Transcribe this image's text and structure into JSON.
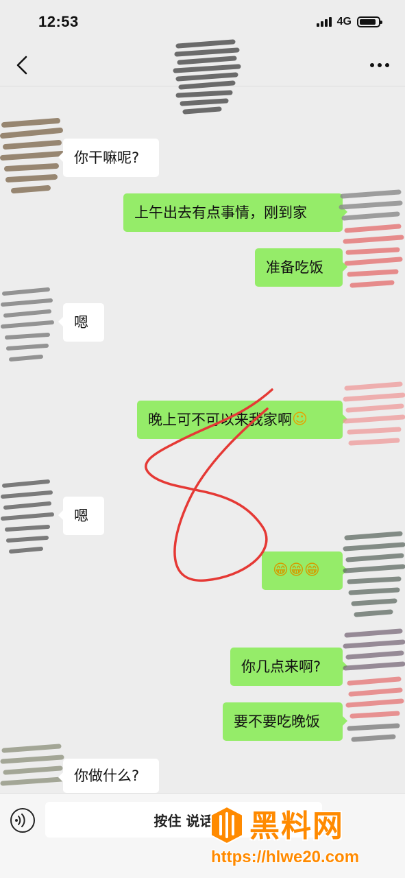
{
  "status_bar": {
    "time": "12:53",
    "network": "4G",
    "battery_level": 0.9
  },
  "nav": {
    "back_icon": "chevron-left-icon",
    "more_icon": "more-dots-icon"
  },
  "messages": [
    {
      "side": "in",
      "text": "你干嘛呢?"
    },
    {
      "side": "out",
      "text": "上午出去有点事情，刚到家"
    },
    {
      "side": "out",
      "text": "准备吃饭"
    },
    {
      "side": "in",
      "text": "嗯"
    },
    {
      "side": "out",
      "text": "晚上可不可以来我家啊",
      "emoji": "☺"
    },
    {
      "side": "in",
      "text": "嗯"
    },
    {
      "side": "out",
      "text": "",
      "emoji": "😁😁😁"
    },
    {
      "side": "out",
      "text": "你几点来啊?"
    },
    {
      "side": "out",
      "text": "要不要吃晚饭"
    },
    {
      "side": "in",
      "text": "你做什么?"
    }
  ],
  "input_bar": {
    "voice_icon": "voice-icon",
    "hold_to_talk": "按住 说话"
  },
  "watermark": {
    "title": "黑料网",
    "url": "https://hlwe20.com"
  },
  "colors": {
    "background": "#ededed",
    "outgoing_bubble": "#95ec69",
    "incoming_bubble": "#ffffff",
    "annotation": "#e53935",
    "watermark": "#ff8a00"
  }
}
